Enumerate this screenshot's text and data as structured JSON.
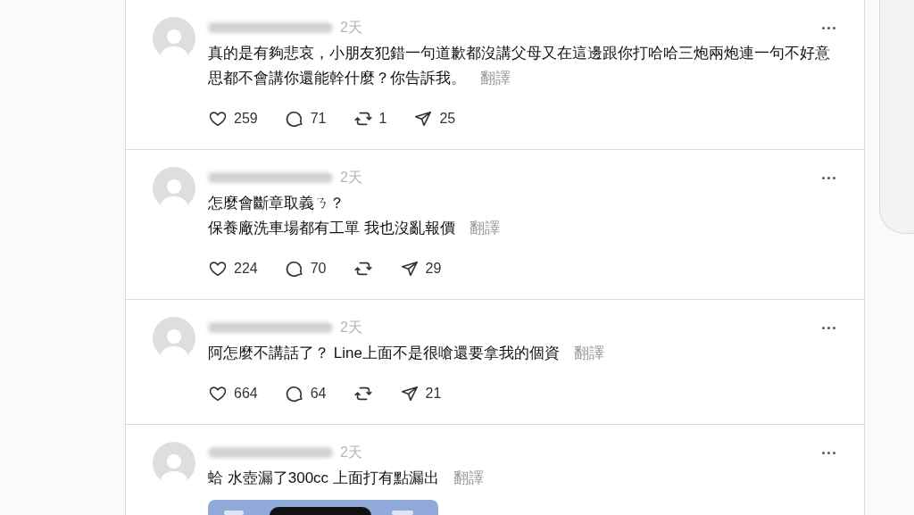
{
  "posts": [
    {
      "time": "2天",
      "lines": [
        "真的是有夠悲哀，小朋友犯錯一句道歉都沒講父母又在這邊跟你打哈哈三炮兩炮連一句不好意思都不會講你還能幹什麼？你告訴我。"
      ],
      "translate": "翻譯",
      "likes": "259",
      "comments": "71",
      "reposts": "1",
      "shares": "25"
    },
    {
      "time": "2天",
      "lines": [
        "怎麼會斷章取義ㄋ？",
        "保養廠洗車場都有工單 我也沒亂報價"
      ],
      "translate": "翻譯",
      "likes": "224",
      "comments": "70",
      "shares": "29"
    },
    {
      "time": "2天",
      "lines": [
        "阿怎麼不講話了？ Line上面不是很嗆還要拿我的個資"
      ],
      "translate": "翻譯",
      "likes": "664",
      "comments": "64",
      "shares": "21"
    },
    {
      "time": "2天",
      "lines": [
        "蛤 水壺漏了300cc 上面打有點漏出"
      ],
      "translate": "翻譯",
      "attachment": {
        "kind": "picture"
      }
    }
  ]
}
